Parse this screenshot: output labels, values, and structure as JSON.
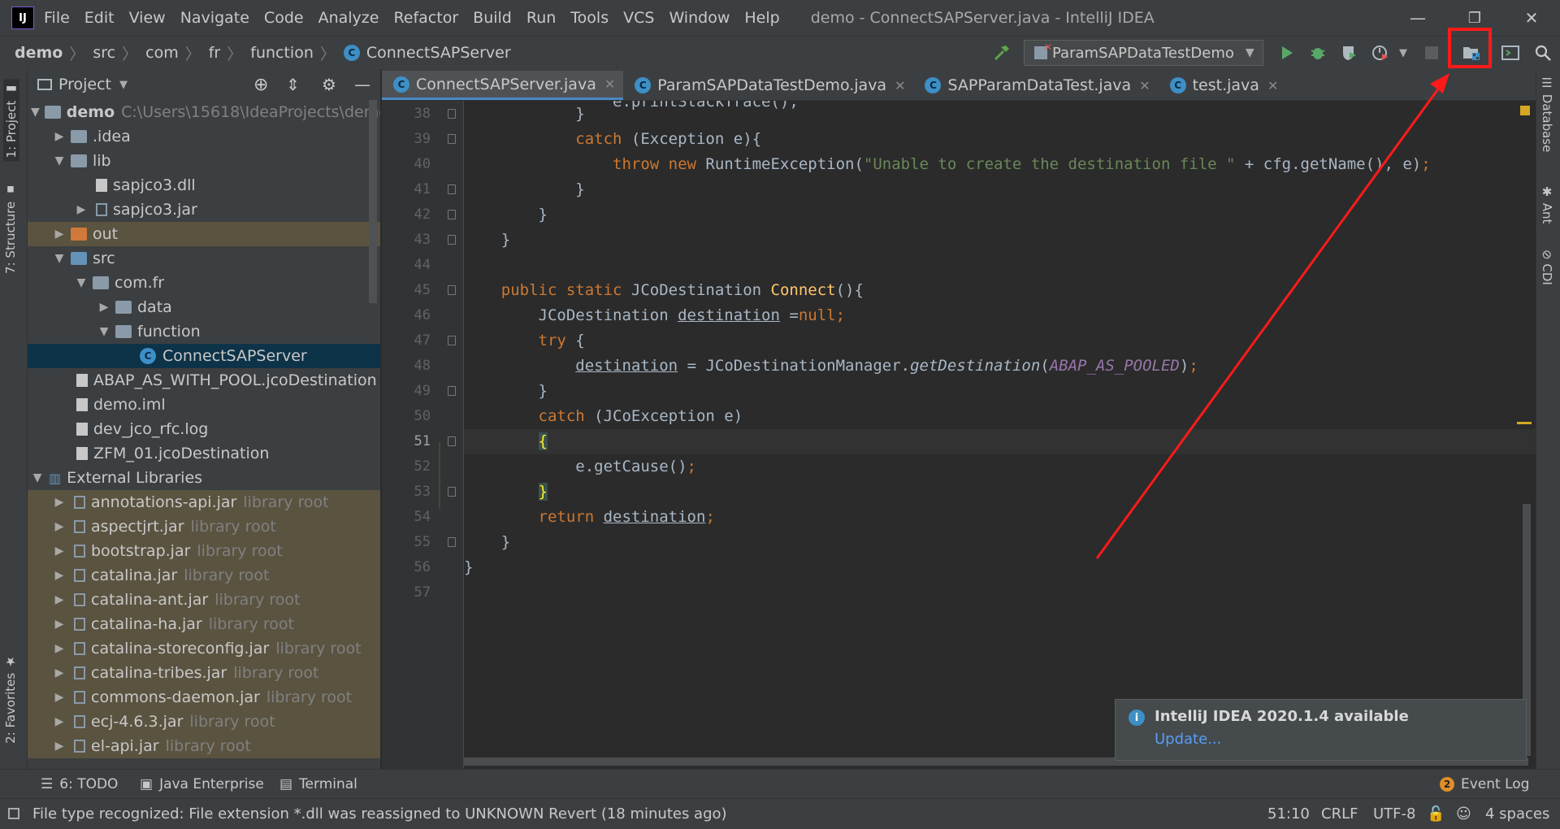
{
  "window": {
    "title": "demo - ConnectSAPServer.java - IntelliJ IDEA",
    "menu": [
      "File",
      "Edit",
      "View",
      "Navigate",
      "Code",
      "Analyze",
      "Refactor",
      "Build",
      "Run",
      "Tools",
      "VCS",
      "Window",
      "Help"
    ],
    "controls": {
      "minimize": "—",
      "restore": "❐",
      "close": "✕"
    }
  },
  "breadcrumb": [
    "demo",
    "src",
    "com",
    "fr",
    "function",
    "ConnectSAPServer"
  ],
  "toolbar": {
    "run_config": "ParamSAPDataTestDemo",
    "icons": [
      "hammer-icon",
      "run-icon",
      "debug-icon",
      "coverage-icon",
      "profile-icon",
      "stop-icon",
      "project-structure-icon",
      "terminal-icon",
      "search-icon"
    ]
  },
  "left_stripe": {
    "project": "1: Project",
    "structure": "7: Structure",
    "favorites": "2: Favorites"
  },
  "project_panel": {
    "title": "Project",
    "tree": [
      {
        "label": "demo",
        "hint": "C:\\Users\\15618\\IdeaProjects\\demo",
        "kind": "module",
        "open": true
      },
      {
        "label": ".idea",
        "kind": "folder",
        "open": false
      },
      {
        "label": "lib",
        "kind": "folder",
        "open": true
      },
      {
        "label": "sapjco3.dll",
        "kind": "file"
      },
      {
        "label": "sapjco3.jar",
        "kind": "jar",
        "open": false
      },
      {
        "label": "out",
        "kind": "folder-out",
        "open": false
      },
      {
        "label": "src",
        "kind": "folder-src",
        "open": true
      },
      {
        "label": "com.fr",
        "kind": "package",
        "open": true
      },
      {
        "label": "data",
        "kind": "package",
        "open": false
      },
      {
        "label": "function",
        "kind": "package",
        "open": true
      },
      {
        "label": "ConnectSAPServer",
        "kind": "class"
      },
      {
        "label": "ABAP_AS_WITH_POOL.jcoDestination",
        "kind": "file"
      },
      {
        "label": "demo.iml",
        "kind": "file"
      },
      {
        "label": "dev_jco_rfc.log",
        "kind": "file"
      },
      {
        "label": "ZFM_01.jcoDestination",
        "kind": "file"
      },
      {
        "label": "External Libraries",
        "kind": "libs",
        "open": true
      },
      {
        "label": "annotations-api.jar",
        "hint": "library root",
        "kind": "jar"
      },
      {
        "label": "aspectjrt.jar",
        "hint": "library root",
        "kind": "jar"
      },
      {
        "label": "bootstrap.jar",
        "hint": "library root",
        "kind": "jar"
      },
      {
        "label": "catalina.jar",
        "hint": "library root",
        "kind": "jar"
      },
      {
        "label": "catalina-ant.jar",
        "hint": "library root",
        "kind": "jar"
      },
      {
        "label": "catalina-ha.jar",
        "hint": "library root",
        "kind": "jar"
      },
      {
        "label": "catalina-storeconfig.jar",
        "hint": "library root",
        "kind": "jar"
      },
      {
        "label": "catalina-tribes.jar",
        "hint": "library root",
        "kind": "jar"
      },
      {
        "label": "commons-daemon.jar",
        "hint": "library root",
        "kind": "jar"
      },
      {
        "label": "ecj-4.6.3.jar",
        "hint": "library root",
        "kind": "jar"
      },
      {
        "label": "el-api.jar",
        "hint": "library root",
        "kind": "jar"
      }
    ]
  },
  "tabs": [
    {
      "label": "ConnectSAPServer.java",
      "active": true
    },
    {
      "label": "ParamSAPDataTestDemo.java",
      "active": false
    },
    {
      "label": "SAPParamDataTest.java",
      "active": false
    },
    {
      "label": "test.java",
      "active": false
    }
  ],
  "editor": {
    "line_numbers": [
      "38",
      "39",
      "40",
      "41",
      "42",
      "43",
      "44",
      "45",
      "46",
      "47",
      "48",
      "49",
      "50",
      "51",
      "52",
      "53",
      "54",
      "55",
      "56",
      "57"
    ],
    "current_line": "51"
  },
  "right_stripe": [
    "Database",
    "Ant",
    "CDI"
  ],
  "notification": {
    "title": "IntelliJ IDEA 2020.1.4 available",
    "link": "Update..."
  },
  "bottom_tools": {
    "todo": "6: TODO",
    "java_enterprise": "Java Enterprise",
    "terminal": "Terminal",
    "event_log": "Event Log",
    "event_count": "2"
  },
  "status": {
    "message": "File type recognized: File extension *.dll was reassigned to UNKNOWN Revert (18 minutes ago)",
    "position": "51:10",
    "line_sep": "CRLF",
    "encoding": "UTF-8",
    "indent": "4 spaces"
  },
  "colors": {
    "accent": "#4a88c7",
    "annotation_red": "#ff1a1a",
    "keyword": "#cc7832",
    "string": "#6a8759",
    "method": "#ffc66d",
    "constant": "#9876aa"
  }
}
